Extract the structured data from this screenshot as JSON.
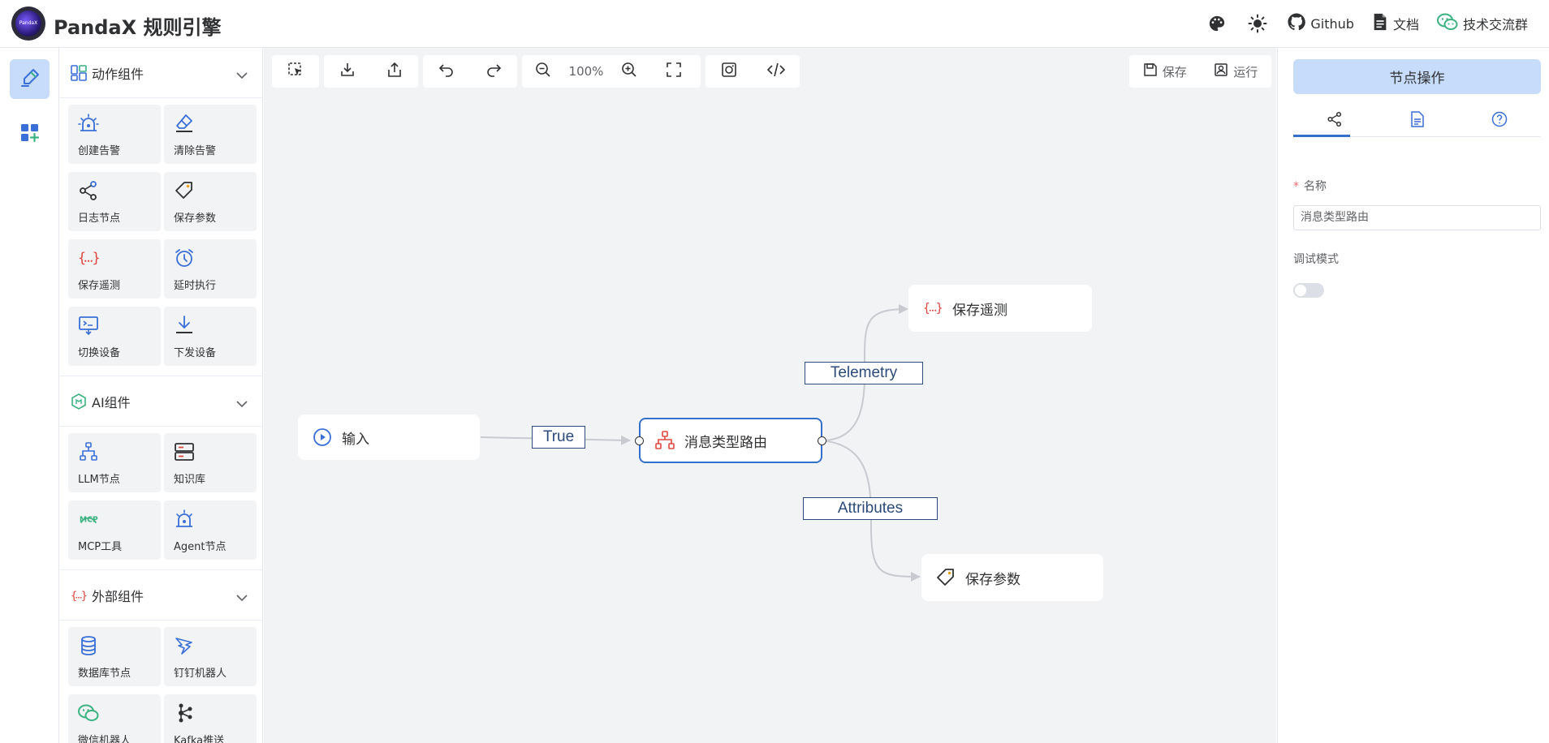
{
  "header": {
    "logo_text": "PandaX",
    "title": "PandaX 规则引擎",
    "links": [
      {
        "label": "Github",
        "icon": "github-icon"
      },
      {
        "label": "文档",
        "icon": "document-icon"
      },
      {
        "label": "技术交流群",
        "icon": "wechat-icon"
      }
    ]
  },
  "rail": {
    "items": [
      {
        "icon": "pen-icon",
        "active": true
      },
      {
        "icon": "apps-add-icon",
        "active": false
      }
    ]
  },
  "panel": {
    "groups": [
      {
        "title": "动作组件",
        "icon": "components-icon",
        "items": [
          "创建告警",
          "清除告警",
          "日志节点",
          "保存参数",
          "保存遥测",
          "延时执行",
          "切换设备",
          "下发设备"
        ]
      },
      {
        "title": "AI组件",
        "icon": "ai-icon",
        "items": [
          "LLM节点",
          "知识库",
          "MCP工具",
          "Agent节点"
        ]
      },
      {
        "title": "外部组件",
        "icon": "braces-icon",
        "items": [
          "数据库节点",
          "钉钉机器人",
          "微信机器人",
          "Kafka推送"
        ]
      }
    ]
  },
  "toolbar": {
    "zoom": "100%",
    "save_label": "保存",
    "run_label": "运行"
  },
  "flow": {
    "nodes": {
      "input": "输入",
      "router": "消息类型路由",
      "telemetry": "保存遥测",
      "attributes": "保存参数"
    },
    "edges": {
      "true_label": "True",
      "telemetry_label": "Telemetry",
      "attributes_label": "Attributes"
    }
  },
  "right_panel": {
    "title": "节点操作",
    "name_label": "名称",
    "name_value": "消息类型路由",
    "debug_label": "调试模式",
    "debug_enabled": false
  },
  "colors": {
    "accent": "#3370cc",
    "active_bg": "#c6dcfa",
    "icon_blue": "#3a6fd8",
    "icon_red": "#e0463c",
    "icon_green": "#3bb27f",
    "canvas_bg": "#f2f3f5"
  }
}
